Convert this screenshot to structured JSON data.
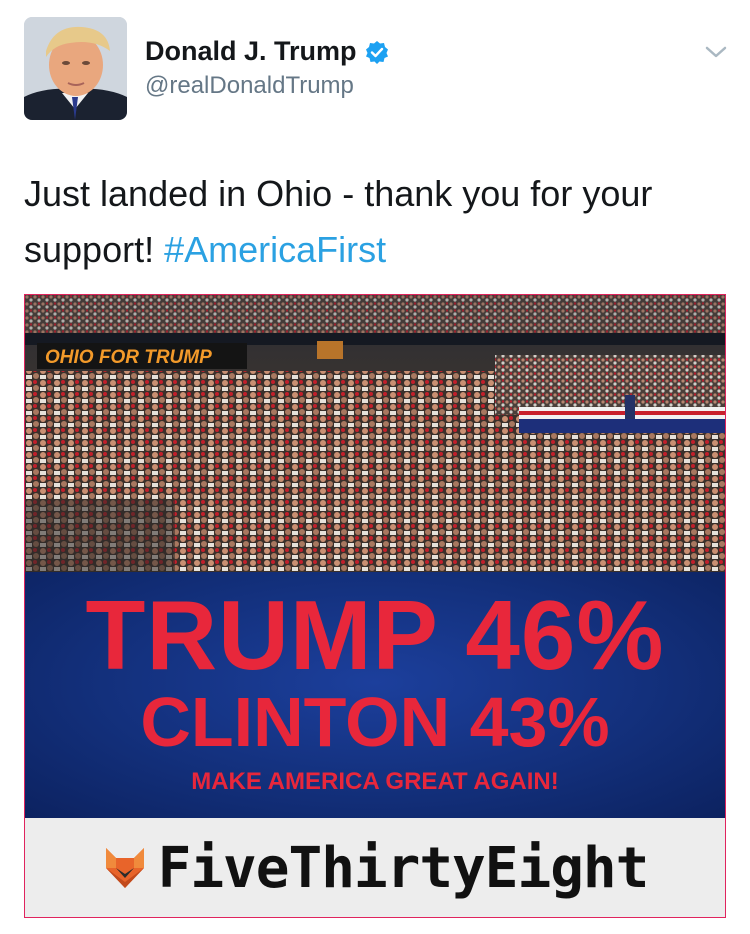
{
  "author": {
    "display_name": "Donald J. Trump",
    "handle": "@realDonaldTrump",
    "verified_icon": "verified-badge-icon",
    "menu_icon": "chevron-down-icon"
  },
  "tweet": {
    "text": "Just landed in Ohio - thank you for your support!",
    "hashtag": "#AmericaFirst"
  },
  "media": {
    "photo_banner": "OHIO FOR TRUMP",
    "poll_line1": "TRUMP 46%",
    "poll_line2": "CLINTON 43%",
    "slogan": "MAKE AMERICA GREAT AGAIN!",
    "brand": "FiveThirtyEight",
    "brand_icon": "fox-logo-icon"
  },
  "colors": {
    "hashtag": "#2ba1e2",
    "verified": "#1da1f2",
    "poll_red": "#e8273b",
    "poll_blue": "#13307c",
    "media_border": "#e0245e"
  }
}
